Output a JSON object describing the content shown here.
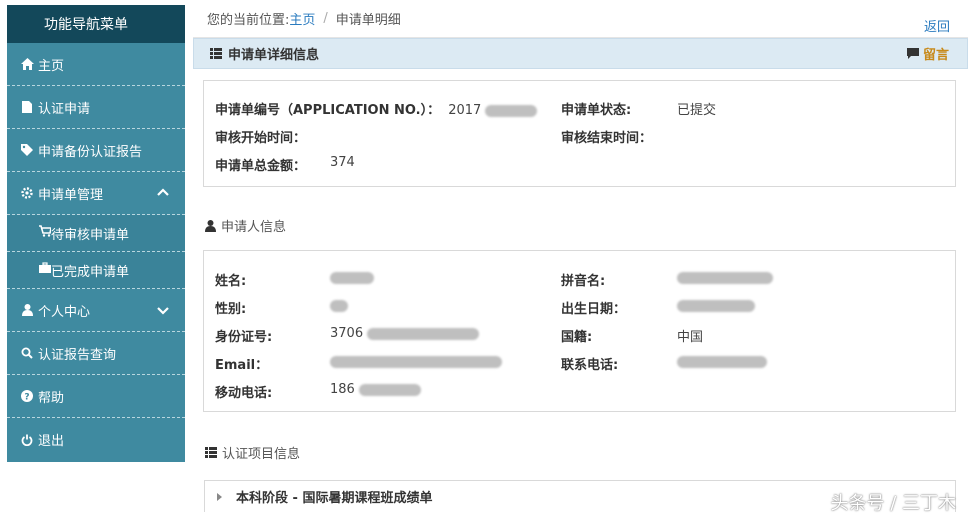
{
  "sidebar": {
    "title": "功能导航菜单",
    "items": [
      {
        "label": "主页",
        "icon": "home-icon"
      },
      {
        "label": "认证申请",
        "icon": "document-icon"
      },
      {
        "label": "申请备份认证报告",
        "icon": "tag-icon"
      },
      {
        "label": "申请单管理",
        "icon": "gear-icon"
      },
      {
        "label": "待审核申请单",
        "icon": "cart-icon"
      },
      {
        "label": "已完成申请单",
        "icon": "briefcase-icon"
      },
      {
        "label": "个人中心",
        "icon": "user-icon"
      },
      {
        "label": "认证报告查询",
        "icon": "search-icon"
      },
      {
        "label": "帮助",
        "icon": "help-icon"
      },
      {
        "label": "退出",
        "icon": "power-icon"
      }
    ]
  },
  "breadcrumb": {
    "prefix": "您的当前位置:",
    "home": "主页",
    "separator": "/",
    "current": "申请单明细",
    "back": "返回"
  },
  "header": {
    "title": "申请单详细信息",
    "message": "留言"
  },
  "application": {
    "number_label": "申请单编号（APPLICATION NO.）：",
    "number_value": "2017",
    "status_label": "申请单状态:",
    "status_value": "已提交",
    "review_start_label": "审核开始时间：",
    "review_end_label": "审核结束时间：",
    "total_label": "申请单总金额：",
    "total_value": "374"
  },
  "applicant": {
    "section_title": "申请人信息",
    "name_label": "姓名:",
    "pinyin_label": "拼音名:",
    "gender_label": "性别:",
    "birth_label": "出生日期：",
    "id_label": "身份证号:",
    "id_value": "3706",
    "nationality_label": "国籍:",
    "nationality_value": "中国",
    "email_label": "Email：",
    "phone_label": "联系电话:",
    "mobile_label": "移动电话:",
    "mobile_value": "186"
  },
  "certification": {
    "section_title": "认证项目信息",
    "item": "本科阶段 - 国际暑期课程班成绩单"
  },
  "watermark": "头条号 / 三丁木"
}
